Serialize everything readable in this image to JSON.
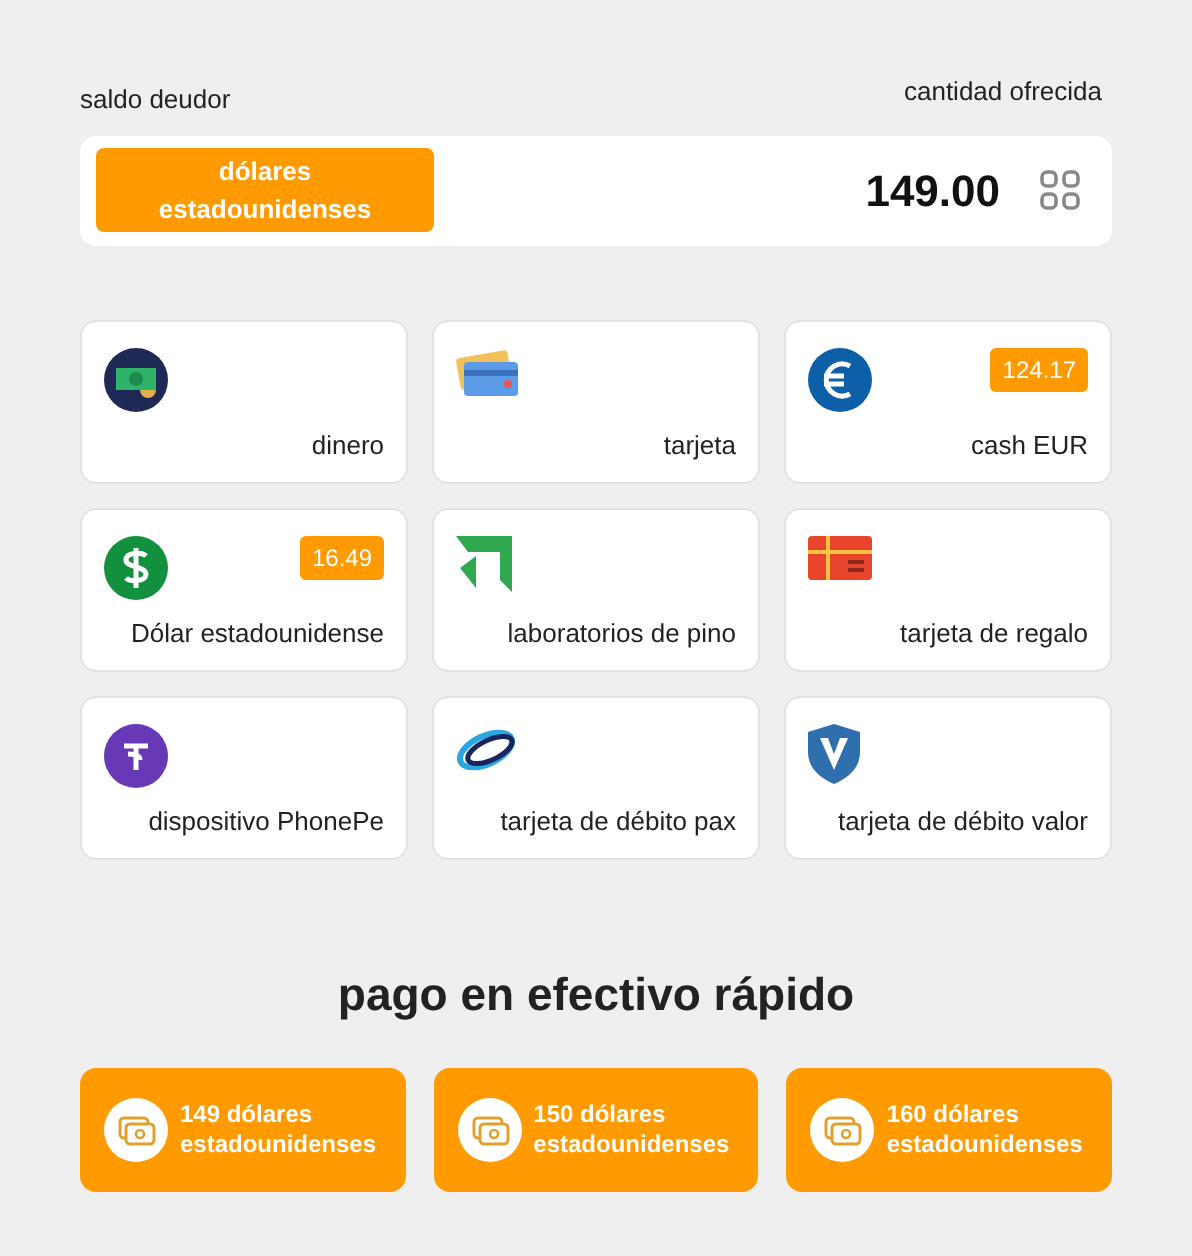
{
  "header": {
    "left_label": "saldo deudor",
    "right_label": "cantidad ofrecida"
  },
  "amount_bar": {
    "currency_button": "dólares estadounidenses",
    "amount": "149.00"
  },
  "methods": [
    {
      "kind": "cash",
      "label": "dinero"
    },
    {
      "kind": "card",
      "label": "tarjeta"
    },
    {
      "kind": "euro",
      "label": "cash EUR",
      "badge": "124.17"
    },
    {
      "kind": "dollar",
      "label": "Dólar estadounidense",
      "badge": "16.49"
    },
    {
      "kind": "pine",
      "label": "laboratorios de pino"
    },
    {
      "kind": "gift",
      "label": "tarjeta de regalo"
    },
    {
      "kind": "phonepe",
      "label": "dispositivo PhonePe"
    },
    {
      "kind": "pax",
      "label": "tarjeta de débito pax"
    },
    {
      "kind": "valor",
      "label": "tarjeta de débito valor"
    }
  ],
  "quick_cash": {
    "title": "pago en efectivo rápido",
    "options": [
      {
        "line1": "149 dólares",
        "line2": "estadounidenses"
      },
      {
        "line1": "150 dólares",
        "line2": "estadounidenses"
      },
      {
        "line1": "160 dólares",
        "line2": "estadounidenses"
      }
    ]
  }
}
